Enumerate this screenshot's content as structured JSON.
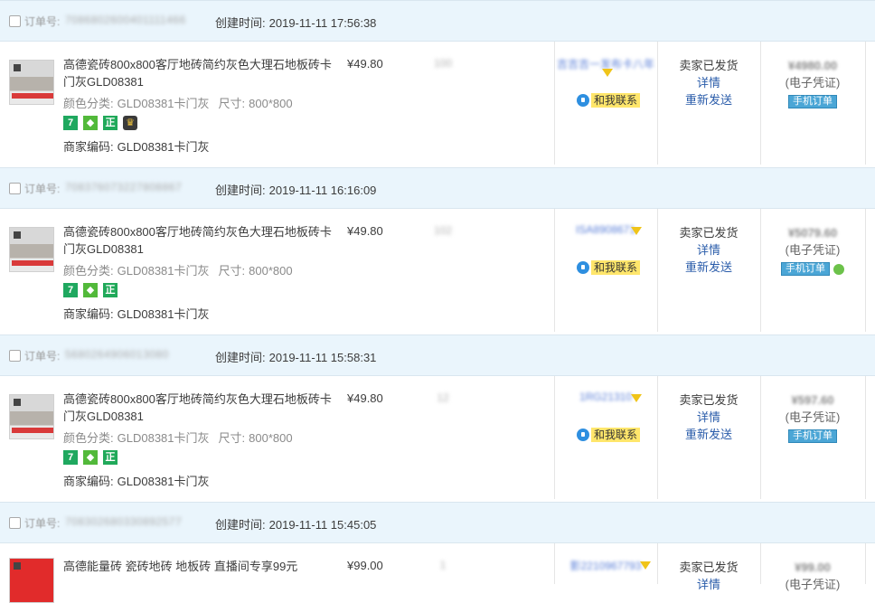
{
  "orders": [
    {
      "order_label": "订单号:",
      "order_no": "7086802600401111466",
      "created_label": "创建时间:",
      "created_time": "2019-11-11 17:56:38",
      "product_title": "高德瓷砖800x800客厅地砖简约灰色大理石地板砖卡门灰GLD08381",
      "sku_color_label": "颜色分类:",
      "sku_color": "GLD08381卡门灰",
      "sku_size_label": "尺寸:",
      "sku_size": "800*800",
      "merchant_code_label": "商家编码:",
      "merchant_code": "GLD08381卡门灰",
      "price": "¥49.80",
      "quantity": "100",
      "buyer": "吉吉吉一发布卡八年",
      "contact": "和我联系",
      "status": "卖家已发货",
      "detail_link": "详情",
      "resend_link": "重新发送",
      "amount": "¥4980.00",
      "voucher": "(电子凭证)",
      "mobile_tag": "手机订单"
    },
    {
      "order_label": "订单号:",
      "order_no": "708376073227808867",
      "created_label": "创建时间:",
      "created_time": "2019-11-11 16:16:09",
      "product_title": "高德瓷砖800x800客厅地砖简约灰色大理石地板砖卡门灰GLD08381",
      "sku_color_label": "颜色分类:",
      "sku_color": "GLD08381卡门灰",
      "sku_size_label": "尺寸:",
      "sku_size": "800*800",
      "merchant_code_label": "商家编码:",
      "merchant_code": "GLD08381卡门灰",
      "price": "¥49.80",
      "quantity": "102",
      "buyer": "ISA8908671",
      "contact": "和我联系",
      "status": "卖家已发货",
      "detail_link": "详情",
      "resend_link": "重新发送",
      "amount": "¥5079.60",
      "voucher": "(电子凭证)",
      "mobile_tag": "手机订单"
    },
    {
      "order_label": "订单号:",
      "order_no": "5680264906013080",
      "created_label": "创建时间:",
      "created_time": "2019-11-11 15:58:31",
      "product_title": "高德瓷砖800x800客厅地砖简约灰色大理石地板砖卡门灰GLD08381",
      "sku_color_label": "颜色分类:",
      "sku_color": "GLD08381卡门灰",
      "sku_size_label": "尺寸:",
      "sku_size": "800*800",
      "merchant_code_label": "商家编码:",
      "merchant_code": "GLD08381卡门灰",
      "price": "¥49.80",
      "quantity": "12",
      "buyer": "1RG21310",
      "contact": "和我联系",
      "status": "卖家已发货",
      "detail_link": "详情",
      "resend_link": "重新发送",
      "amount": "¥597.60",
      "voucher": "(电子凭证)",
      "mobile_tag": "手机订单"
    },
    {
      "order_label": "订单号:",
      "order_no": "708302680330892577",
      "created_label": "创建时间:",
      "created_time": "2019-11-11 15:45:05",
      "product_title": "高德能量砖 瓷砖地砖 地板砖 直播间专享99元",
      "price": "¥99.00",
      "quantity": "1",
      "buyer": "影2210967793",
      "status": "卖家已发货",
      "detail_link": "详情",
      "amount": "¥99.00",
      "voucher": "(电子凭证)"
    }
  ],
  "badges": {
    "seven_day": "7",
    "genuine": "正"
  },
  "colors": {
    "header_bg": "#eaf5fc",
    "link": "#2a5caa",
    "contact_bg": "#ffe66b",
    "badge_green": "#1fa85f"
  }
}
